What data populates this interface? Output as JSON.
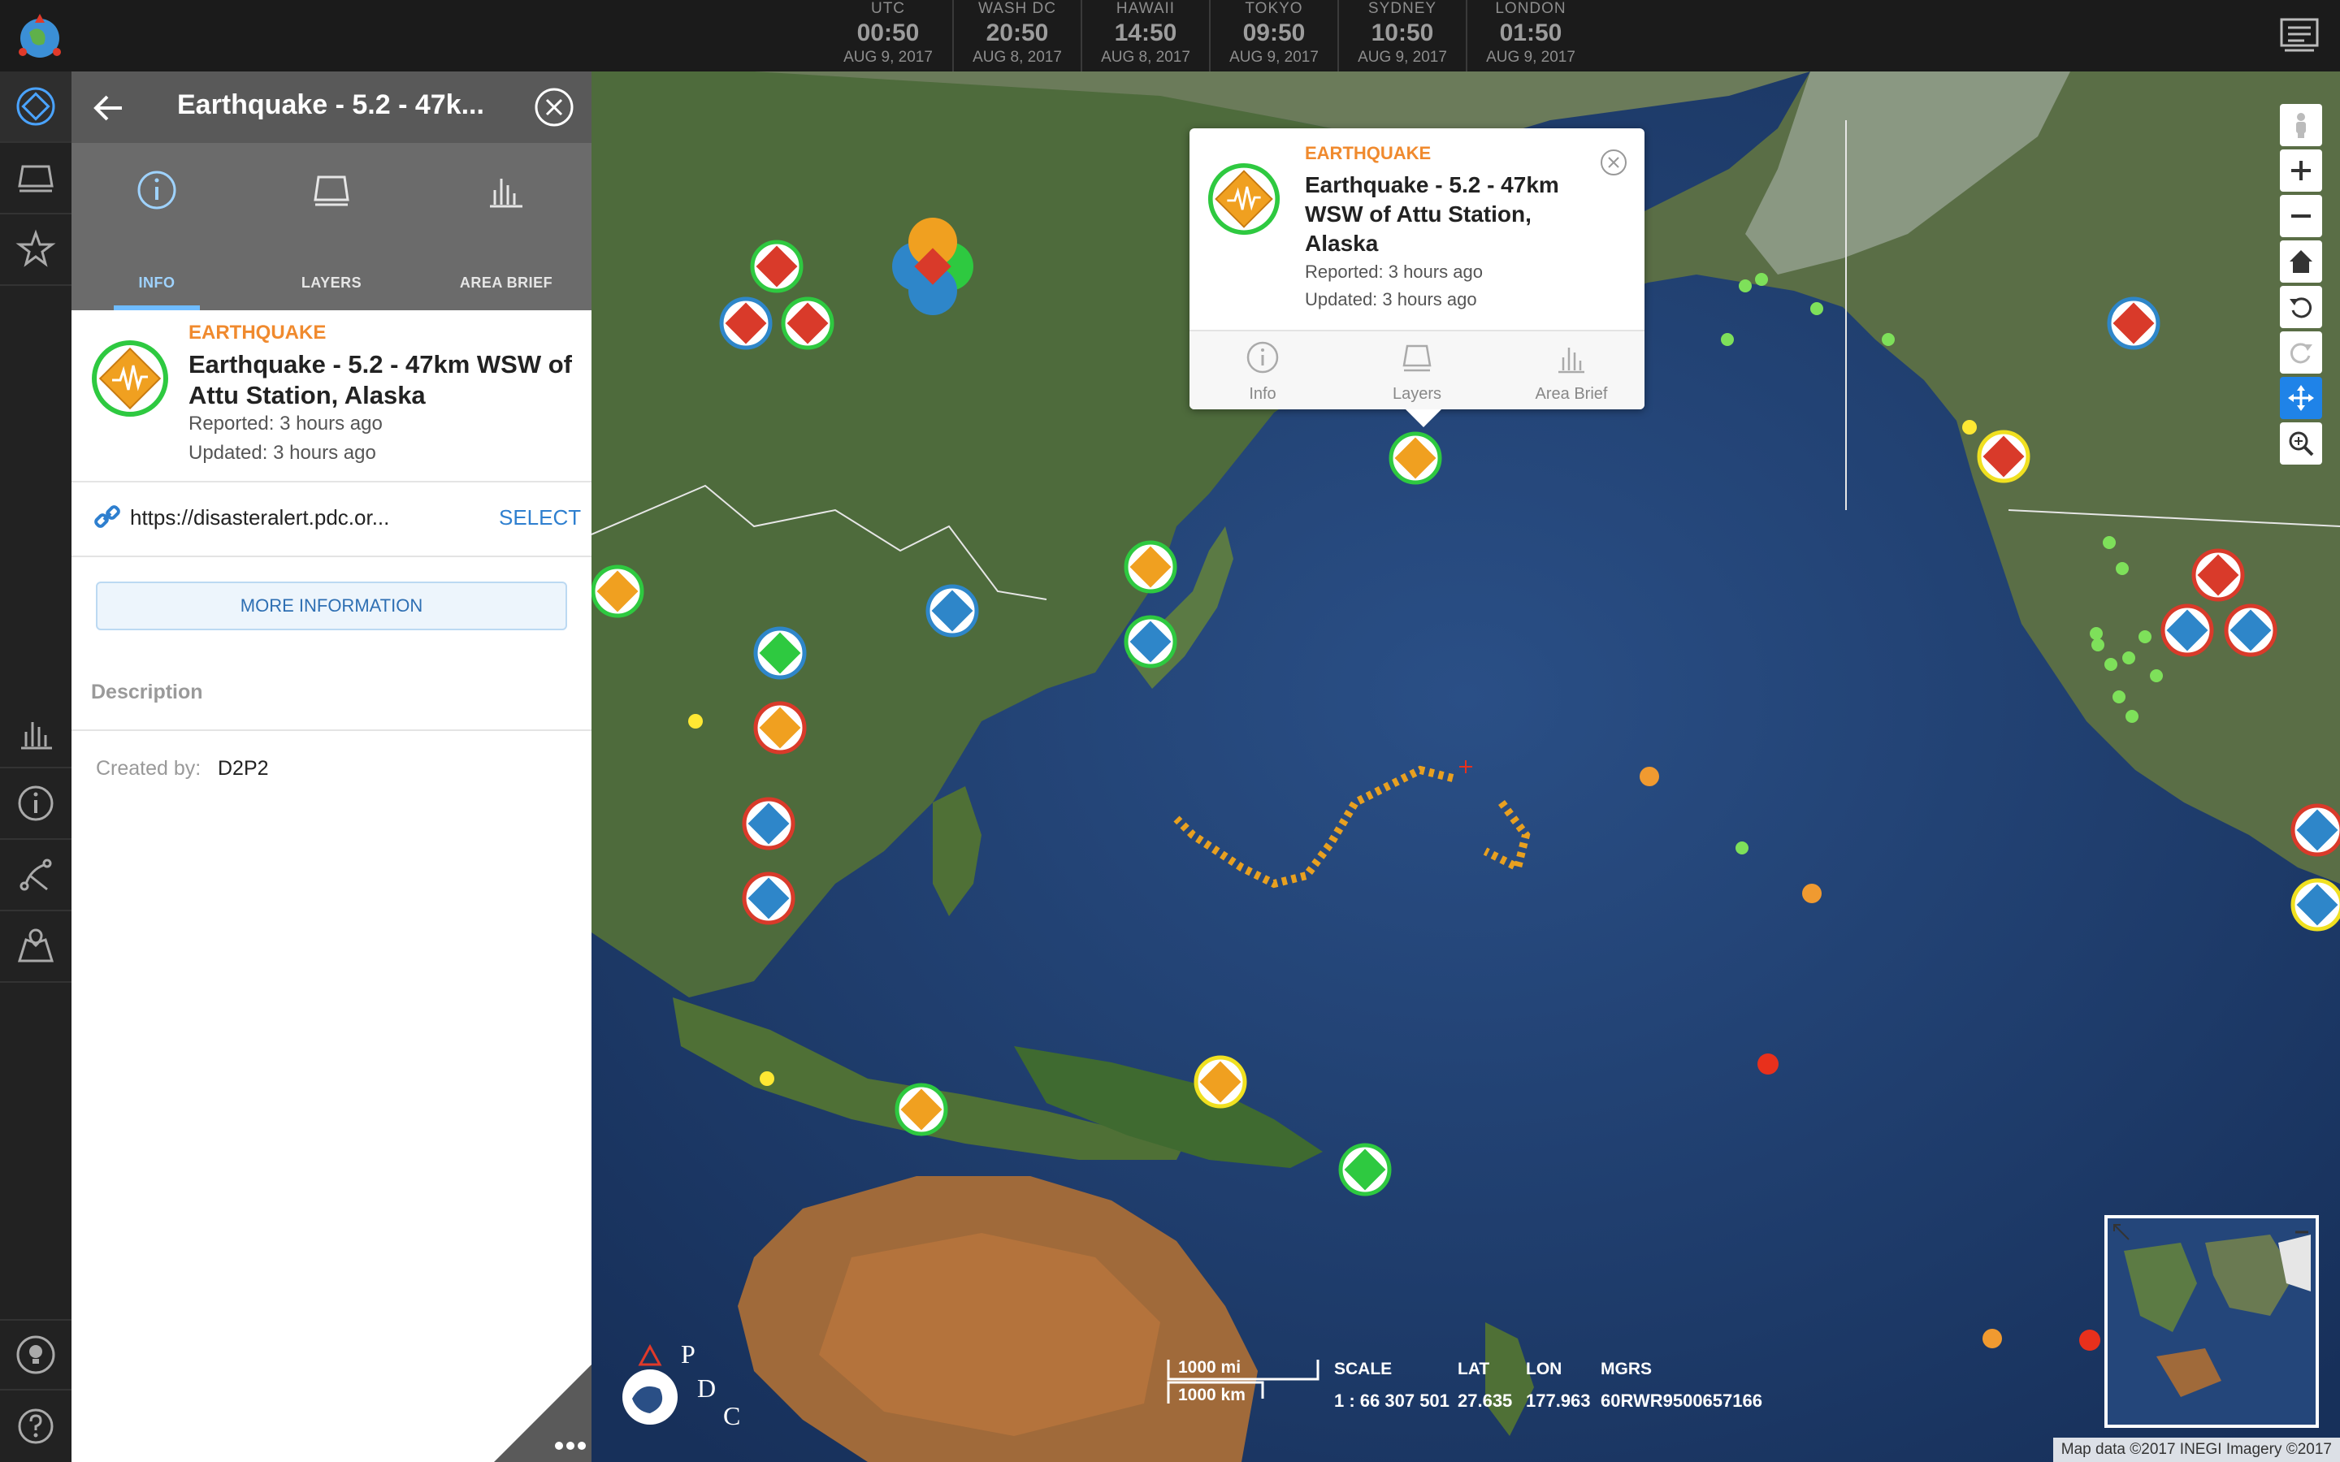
{
  "clocks": [
    {
      "city": "UTC",
      "time": "00:50",
      "date": "AUG 9, 2017"
    },
    {
      "city": "WASH DC",
      "time": "20:50",
      "date": "AUG 8, 2017"
    },
    {
      "city": "HAWAII",
      "time": "14:50",
      "date": "AUG 8, 2017"
    },
    {
      "city": "TOKYO",
      "time": "09:50",
      "date": "AUG 9, 2017"
    },
    {
      "city": "SYDNEY",
      "time": "10:50",
      "date": "AUG 9, 2017"
    },
    {
      "city": "LONDON",
      "time": "01:50",
      "date": "AUG 9, 2017"
    }
  ],
  "panel": {
    "title": "Earthquake - 5.2 - 47k...",
    "tabs": [
      {
        "label": "INFO",
        "icon": "info-icon"
      },
      {
        "label": "LAYERS",
        "icon": "layers-icon"
      },
      {
        "label": "AREA BRIEF",
        "icon": "bar-chart-icon"
      }
    ],
    "event": {
      "category": "EARTHQUAKE",
      "title": "Earthquake - 5.2 - 47km WSW of Attu Station, Alaska",
      "reported": "Reported: 3 hours ago",
      "updated": "Updated: 3 hours ago"
    },
    "link": {
      "url": "https://disasteralert.pdc.or...",
      "action": "SELECT"
    },
    "more_button": "MORE INFORMATION",
    "description_label": "Description",
    "created_by_label": "Created by:",
    "created_by_value": "D2P2"
  },
  "popup": {
    "category": "EARTHQUAKE",
    "title": "Earthquake - 5.2 - 47km WSW of Attu Station, Alaska",
    "reported": "Reported: 3 hours ago",
    "updated": "Updated: 3 hours ago",
    "actions": [
      {
        "label": "Info",
        "icon": "info-icon"
      },
      {
        "label": "Layers",
        "icon": "layers-icon"
      },
      {
        "label": "Area Brief",
        "icon": "bar-chart-icon"
      }
    ]
  },
  "map": {
    "scale_mi": "1000 mi",
    "scale_km": "1000 km",
    "scale_label": "SCALE",
    "scale_value": "1 : 66 307 501",
    "lat_label": "LAT",
    "lat_value": "27.635",
    "lon_label": "LON",
    "lon_value": "177.963",
    "mgrs_label": "MGRS",
    "mgrs_value": "60RWR9500657166",
    "attribution": "Map data ©2017 INEGI Imagery ©2017",
    "logo_letters": "PDC"
  },
  "colors": {
    "ocean": "#1f3e6d",
    "land": "#4b6a3a",
    "hazard_orange": "#f0a020",
    "hazard_red": "#d93a2a",
    "hazard_blue": "#2e86c9",
    "ring_green": "#2ec940",
    "accent_blue": "#1f83e8"
  }
}
